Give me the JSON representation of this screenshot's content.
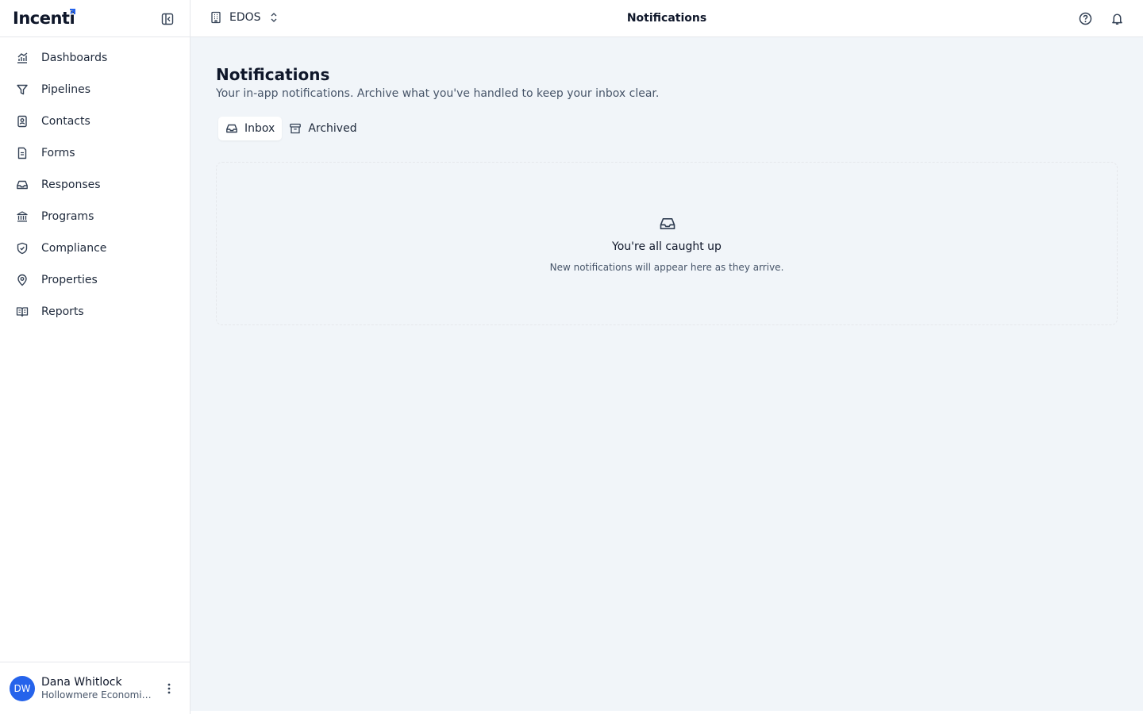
{
  "brand": {
    "name": "Incenti"
  },
  "sidebar": {
    "items": [
      {
        "label": "Dashboards",
        "icon": "chart-icon"
      },
      {
        "label": "Pipelines",
        "icon": "filter-icon"
      },
      {
        "label": "Contacts",
        "icon": "contact-book-icon"
      },
      {
        "label": "Forms",
        "icon": "document-icon"
      },
      {
        "label": "Responses",
        "icon": "inbox-icon"
      },
      {
        "label": "Programs",
        "icon": "bank-icon"
      },
      {
        "label": "Compliance",
        "icon": "shield-check-icon"
      },
      {
        "label": "Properties",
        "icon": "map-pin-icon"
      },
      {
        "label": "Reports",
        "icon": "book-open-icon"
      }
    ]
  },
  "user": {
    "initials": "DW",
    "name": "Dana Whitlock",
    "org": "Hollowmere Economic Development"
  },
  "topbar": {
    "org_label": "EDOS",
    "title": "Notifications"
  },
  "page": {
    "title": "Notifications",
    "subtitle": "Your in-app notifications. Archive what you've handled to keep your inbox clear.",
    "tabs": [
      {
        "label": "Inbox",
        "active": true
      },
      {
        "label": "Archived",
        "active": false
      }
    ],
    "empty": {
      "title": "You're all caught up",
      "message": "New notifications will appear here as they arrive."
    }
  },
  "colors": {
    "accent": "#2563eb",
    "background": "#f1f5f9"
  }
}
